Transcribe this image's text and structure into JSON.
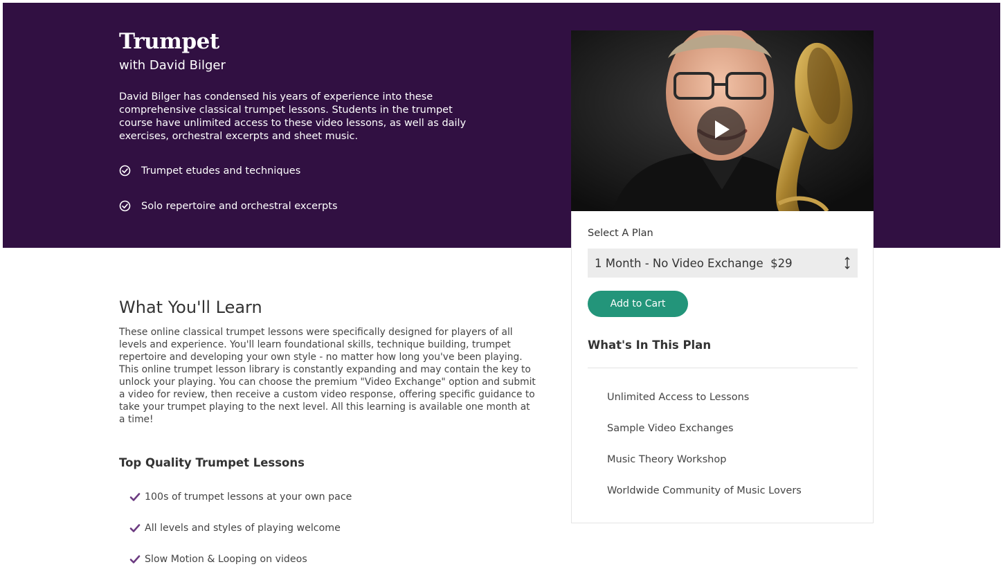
{
  "hero": {
    "title": "Trumpet",
    "instructor": "with David Bilger",
    "description": "David Bilger has condensed his years of experience into these comprehensive classical trumpet lessons. Students in the trumpet course have unlimited access to these video lessons, as well as daily exercises, orchestral excerpts and sheet music.",
    "features": [
      "Trumpet etudes and techniques",
      "Solo repertoire and orchestral excerpts"
    ],
    "background_color": "#311042"
  },
  "video": {
    "play_icon": "play-icon"
  },
  "plan": {
    "label": "Select A Plan",
    "selected_option": "1 Month - No Video Exchange  $29",
    "add_to_cart": "Add to Cart",
    "heading": "What's In This Plan",
    "items": [
      "Unlimited Access to Lessons",
      "Sample Video Exchanges",
      "Music Theory Workshop",
      "Worldwide Community of Music Lovers"
    ],
    "button_color": "#23957a"
  },
  "learn": {
    "title": "What You'll Learn",
    "text": "These online classical trumpet lessons were specifically designed for players of all levels and experience. You'll learn foundational skills, technique building, trumpet repertoire and developing your own style - no matter how long you've been playing. This online trumpet lesson library is constantly expanding and may contain the key to unlock your playing. You can choose the premium \"Video Exchange\" option and submit a video for review, then receive a custom video response, offering specific guidance to take your trumpet playing to the next level. All this learning is available one month at a time!",
    "subheading": "Top Quality Trumpet Lessons",
    "items": [
      "100s of trumpet lessons at your own pace",
      "All levels and styles of playing welcome",
      "Slow Motion & Looping on videos"
    ],
    "check_color": "#6b3a80"
  }
}
